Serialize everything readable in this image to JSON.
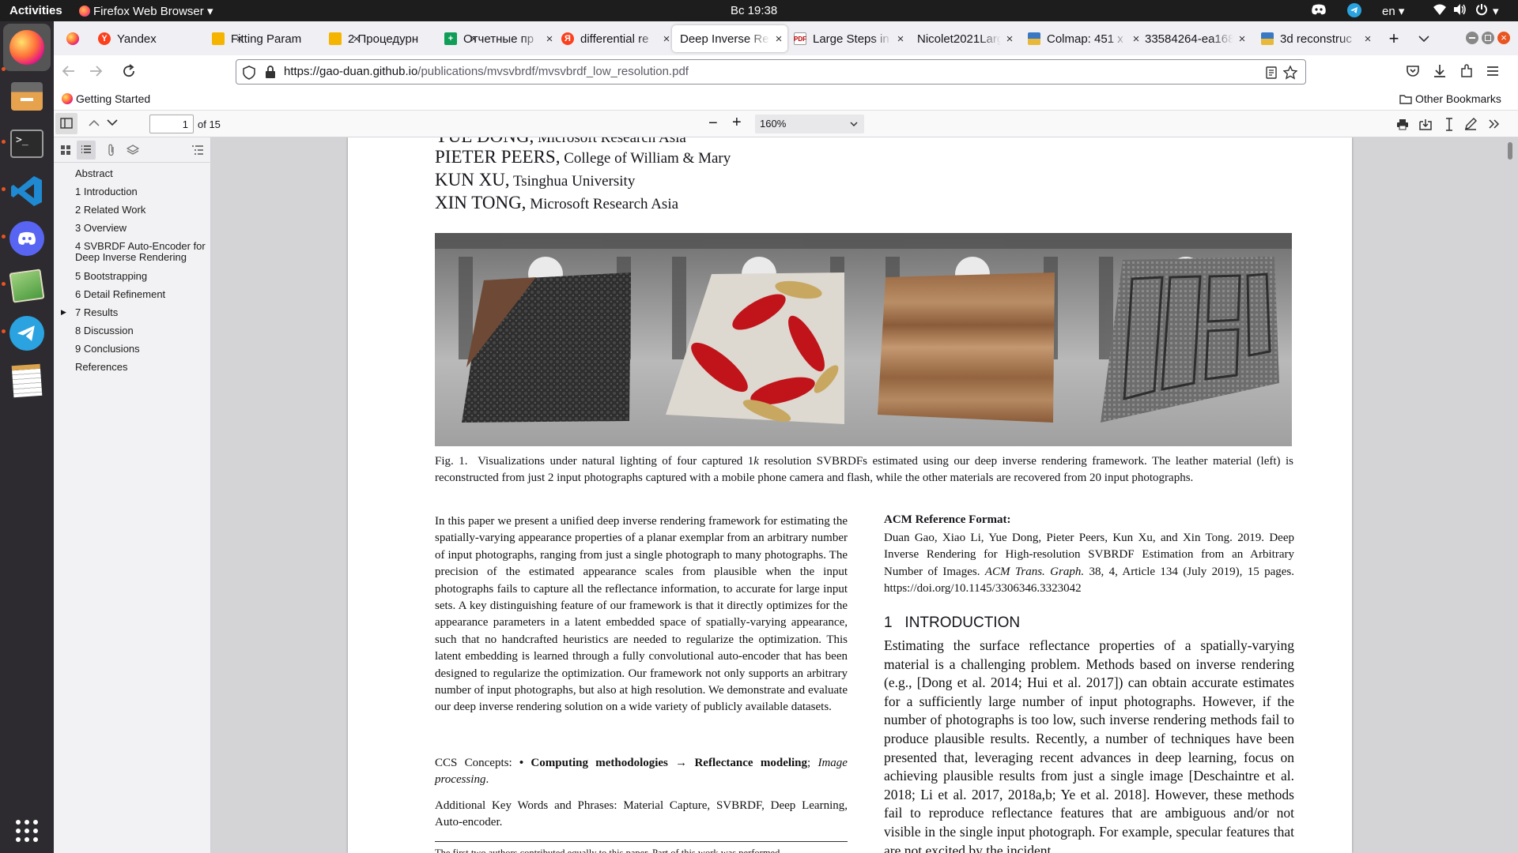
{
  "system_bar": {
    "activities": "Activities",
    "app_name": "Firefox Web Browser",
    "clock": "Вс 19:38",
    "language": "en"
  },
  "browser": {
    "tabs": [
      {
        "label": "",
        "icon": "firefox-pinned-icon"
      },
      {
        "label": "Yandex",
        "icon": "yandex-icon"
      },
      {
        "label": "Fitting Param",
        "icon": "slides-icon"
      },
      {
        "label": "2 Процедурн",
        "icon": "slides-icon"
      },
      {
        "label": "Отчетные пр",
        "icon": "sheets-icon"
      },
      {
        "label": "differential re",
        "icon": "yandex-icon"
      },
      {
        "label": "Deep Inverse Re",
        "icon": "",
        "active": true
      },
      {
        "label": "Large Steps in",
        "icon": "paper-icon"
      },
      {
        "label": "Nicolet2021Larg",
        "icon": ""
      },
      {
        "label": "Colmap: 451 x",
        "icon": "image-icon"
      },
      {
        "label": "33584264-ea168",
        "icon": ""
      },
      {
        "label": "3d reconstruc",
        "icon": "image-icon"
      }
    ],
    "url_host": "https://gao-duan.github.io",
    "url_path": "/publications/mvsvbrdf/mvsvbrdf_low_resolution.pdf",
    "bookmark_getting_started": "Getting Started",
    "bookmark_other": "Other Bookmarks"
  },
  "pdf_toolbar": {
    "page_number": "1",
    "page_count": "of 15",
    "zoom": "160%"
  },
  "outline": [
    {
      "label": "Abstract"
    },
    {
      "label": "1 Introduction"
    },
    {
      "label": "2 Related Work"
    },
    {
      "label": "3 Overview"
    },
    {
      "label": "4 SVBRDF Auto-Encoder for",
      "label2": "Deep Inverse Rendering"
    },
    {
      "label": "5 Bootstrapping"
    },
    {
      "label": "6 Detail Refinement"
    },
    {
      "label": "7 Results",
      "collapsed": true
    },
    {
      "label": "8 Discussion"
    },
    {
      "label": "9 Conclusions"
    },
    {
      "label": "References"
    }
  ],
  "paper": {
    "authors": [
      {
        "name": "YUE DONG,",
        "affiliation": " Microsoft Research Asia"
      },
      {
        "name": "PIETER PEERS,",
        "affiliation": " College of William & Mary"
      },
      {
        "name": "KUN XU,",
        "affiliation": " Tsinghua University"
      },
      {
        "name": "XIN TONG,",
        "affiliation": " Microsoft Research Asia"
      }
    ],
    "caption_label": "Fig. 1.",
    "caption_1": "Visualizations under natural lighting of four captured 1",
    "caption_k": "k",
    "caption_2": " resolution SVBRDFs estimated using our deep inverse rendering framework. The leather material (left) is reconstructed from just 2 input photographs captured with a mobile phone camera and flash, while the other materials are recovered from 20 input photographs.",
    "abstract": "In this paper we present a unified deep inverse rendering framework for estimating the spatially-varying appearance properties of a planar exemplar from an arbitrary number of input photographs, ranging from just a single photograph to many photographs. The precision of the estimated appearance scales from plausible when the input photographs fails to capture all the reflectance information, to accurate for large input sets. A key distinguishing feature of our framework is that it directly optimizes for the appearance parameters in a latent embedded space of spatially-varying appearance, such that no handcrafted heuristics are needed to regularize the optimization. This latent embedding is learned through a fully convolutional auto-encoder that has been designed to regularize the optimization. Our framework not only supports an arbitrary number of input photographs, but also at high resolution. We demonstrate and evaluate our deep inverse rendering solution on a wide variety of publicly available datasets.",
    "ccs_prefix": "CCS Concepts: ",
    "ccs_bold": "• Computing methodologies → Reflectance modeling",
    "ccs_sep": "; ",
    "ccs_italic": "Image processing",
    "ccs_end": ".",
    "keywords": "Additional Key Words and Phrases: Material Capture, SVBRDF, Deep Learning, Auto-encoder.",
    "footnote": "The first two authors contributed equally to this paper. Part of this work was performed",
    "acm_heading": "ACM Reference Format:",
    "acm_text_1": "Duan Gao, Xiao Li, Yue Dong, Pieter Peers, Kun Xu, and Xin Tong. 2019. Deep Inverse Rendering for High-resolution SVBRDF Estimation from an Arbitrary Number of Images. ",
    "acm_journal": "ACM Trans. Graph.",
    "acm_text_2": " 38, 4, Article 134 (July 2019), 15 pages. https://doi.org/10.1145/3306346.3323042",
    "intro_number": "1",
    "intro_title": "INTRODUCTION",
    "intro_text": "Estimating the surface reflectance properties of a spatially-varying material is a challenging problem. Methods based on inverse rendering (e.g., [Dong et al. 2014; Hui et al. 2017]) can obtain accurate estimates for a sufficiently large number of input photographs. However, if the number of photographs is too low, such inverse rendering methods fail to produce plausible results. Recently, a number of techniques have been presented that, leveraging recent advances in deep learning, focus on achieving plausible results from just a single image [Deschaintre et al. 2018; Li et al. 2017, 2018a,b; Ye et al. 2018]. However, these methods fail to reproduce reflectance features that are ambiguous and/or not visible in the single input photograph. For example, specular features that are not excited by the incident"
  }
}
